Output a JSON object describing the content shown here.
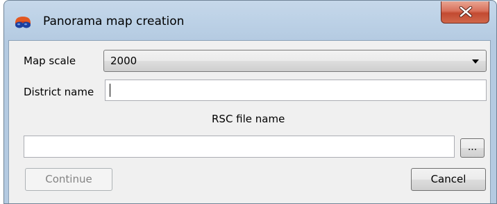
{
  "window": {
    "title": "Panorama map creation",
    "app_icon": "panorama-glasses-icon",
    "close_icon": "close-x-icon"
  },
  "form": {
    "map_scale_label": "Map scale",
    "map_scale_value": "2000",
    "district_name_label": "District name",
    "district_name_value": "",
    "rsc_file_label": "RSC file name",
    "rsc_file_value": "",
    "browse_label": "..."
  },
  "buttons": {
    "continue_label": "Continue",
    "cancel_label": "Cancel"
  },
  "colors": {
    "title_bar": "#bcd1e6",
    "close_button": "#c24a31",
    "client_background": "#f0f0f0"
  }
}
